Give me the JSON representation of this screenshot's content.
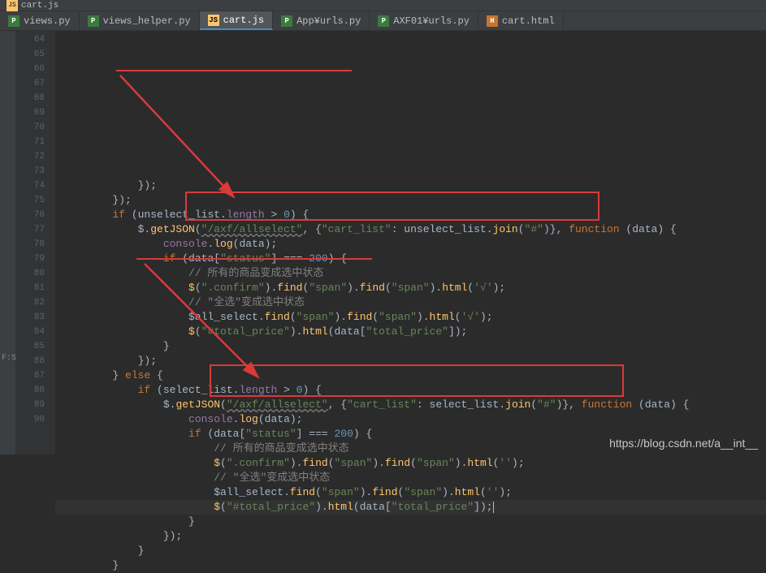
{
  "topbar": {
    "file": "cart.js",
    "lang_icon": "JS"
  },
  "tabs": [
    {
      "label": "views.py",
      "icon": "py",
      "active": false
    },
    {
      "label": "views_helper.py",
      "icon": "py",
      "active": false
    },
    {
      "label": "cart.js",
      "icon": "js",
      "active": true
    },
    {
      "label": "App¥urls.py",
      "icon": "py",
      "active": false
    },
    {
      "label": "AXF01¥urls.py",
      "icon": "py",
      "active": false
    },
    {
      "label": "cart.html",
      "icon": "html",
      "active": false
    }
  ],
  "line_start": 64,
  "line_count": 27,
  "highlighted_line": 86,
  "sidebar_label": "F:S",
  "code": {
    "l64": {
      "indent": "            ",
      "text": "});"
    },
    "l65": {
      "indent": "        ",
      "text": "});"
    },
    "l66": {
      "indent": "        ",
      "kw_if": "if",
      "cond_open": " (unselect_list.",
      "prop": "length",
      "cond_rest": " > ",
      "num": "0",
      "close": ") {"
    },
    "l67": {
      "indent": "            ",
      "jq": "$",
      "fn": "getJSON",
      "arg1": "\"/axf/allselect\"",
      "obj_open": ", {",
      "key": "\"cart_list\"",
      "colon": ": unselect_list.",
      "join_fn": "join",
      "join_arg": "\"#\"",
      "obj_close": ")}, ",
      "kw_fn": "function",
      "params": " (data) {"
    },
    "l68": {
      "indent": "                ",
      "obj": "console",
      "fn": "log",
      "args": "(data);"
    },
    "l69": {
      "indent": "                ",
      "kw_if": "if",
      "open": " (data[",
      "key": "\"status\"",
      "eq": "] === ",
      "num": "200",
      "close": ") {"
    },
    "l70": {
      "indent": "                    ",
      "cmt": "// 所有的商品变成选中状态"
    },
    "l71": {
      "indent": "                    ",
      "jq": "$",
      "sel": "\".confirm\"",
      "find1": "find",
      "arg1": "\"span\"",
      "find2": "find",
      "arg2": "\"span\"",
      "htmlfn": "html",
      "htmlarg": "'√'",
      "end": ";"
    },
    "l72": {
      "indent": "                    ",
      "cmt": "// \"全选\"变成选中状态"
    },
    "l73": {
      "indent": "                    ",
      "var": "$all_select",
      "find1": "find",
      "arg1": "\"span\"",
      "find2": "find",
      "arg2": "\"span\"",
      "htmlfn": "html",
      "htmlarg": "'√'",
      "end": ";"
    },
    "l74": {
      "indent": "                    ",
      "jq": "$",
      "sel": "\"#total_price\"",
      "htmlfn": "html",
      "arg_open": "(data[",
      "key": "\"total_price\"",
      "arg_close": "]);"
    },
    "l75": {
      "indent": "                ",
      "text": "}"
    },
    "l76": {
      "indent": "            ",
      "text": "});"
    },
    "l77": {
      "indent": "        ",
      "close": "} ",
      "kw_else": "else",
      "open": " {"
    },
    "l78": {
      "indent": "            ",
      "kw_if": "if",
      "cond_open": " (select_list.",
      "prop": "length",
      "cond_rest": " > ",
      "num": "0",
      "close": ") {"
    },
    "l79": {
      "indent": "                ",
      "jq": "$",
      "fn": "getJSON",
      "arg1": "\"/axf/allselect\"",
      "obj_open": ", {",
      "key": "\"cart_list\"",
      "colon": ": select_list.",
      "join_fn": "join",
      "join_arg": "\"#\"",
      "obj_close": ")}, ",
      "kw_fn": "function",
      "params": " (data) {"
    },
    "l80": {
      "indent": "                    ",
      "obj": "console",
      "fn": "log",
      "args": "(data);"
    },
    "l81": {
      "indent": "                    ",
      "kw_if": "if",
      "open": " (data[",
      "key": "\"status\"",
      "eq": "] === ",
      "num": "200",
      "close": ") {"
    },
    "l82": {
      "indent": "                        ",
      "cmt": "// 所有的商品变成选中状态"
    },
    "l83": {
      "indent": "                        ",
      "jq": "$",
      "sel": "\".confirm\"",
      "find1": "find",
      "arg1": "\"span\"",
      "find2": "find",
      "arg2": "\"span\"",
      "htmlfn": "html",
      "htmlarg": "''",
      "end": ";"
    },
    "l84": {
      "indent": "                        ",
      "cmt": "// \"全选\"变成选中状态"
    },
    "l85": {
      "indent": "                        ",
      "var": "$all_select",
      "find1": "find",
      "arg1": "\"span\"",
      "find2": "find",
      "arg2": "\"span\"",
      "htmlfn": "html",
      "htmlarg": "''",
      "end": ";"
    },
    "l86": {
      "indent": "                        ",
      "jq": "$",
      "sel": "\"#total_price\"",
      "htmlfn": "html",
      "arg_open": "(data[",
      "key": "\"total_price\"",
      "arg_close": "]);"
    },
    "l87": {
      "indent": "                    ",
      "text": "}"
    },
    "l88": {
      "indent": "                ",
      "text": "});"
    },
    "l89": {
      "indent": "            ",
      "text": "}"
    },
    "l90": {
      "indent": "        ",
      "text": "}"
    }
  },
  "watermark": "https://blog.csdn.net/a__int__"
}
